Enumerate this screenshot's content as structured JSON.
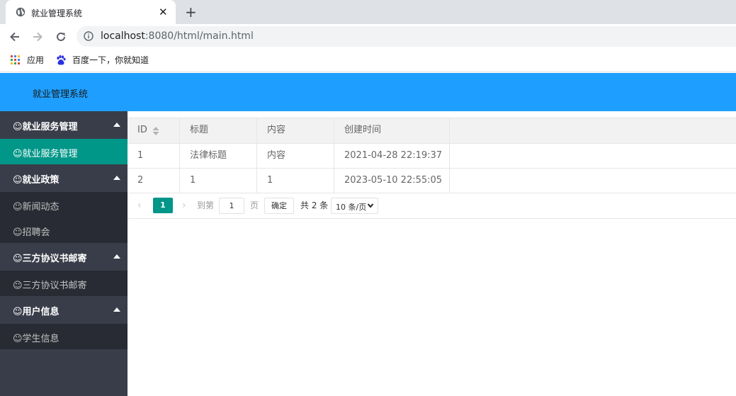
{
  "browser": {
    "tab_title": "就业管理系统",
    "tab_close": "✕",
    "new_tab": "+",
    "url_host": "localhost",
    "url_rest": ":8080/html/main.html",
    "bookmarks": [
      {
        "label": "应用",
        "icon": "apps-grid-icon"
      },
      {
        "label": "百度一下，你就知道",
        "icon": "baidu-paw-icon"
      }
    ]
  },
  "app": {
    "title": "就业管理系统",
    "accent_color": "#1e9fff",
    "active_color": "#009688"
  },
  "sidebar": {
    "groups": [
      {
        "label": "☺就业服务管理",
        "items": [
          {
            "label": "☺就业服务管理",
            "active": true
          }
        ]
      },
      {
        "label": "☺就业政策",
        "items": [
          {
            "label": "☺新闻动态"
          },
          {
            "label": "☺招聘会"
          }
        ]
      },
      {
        "label": "☺三方协议书邮寄",
        "items": [
          {
            "label": "☺三方协议书邮寄"
          }
        ]
      },
      {
        "label": "☺用户信息",
        "items": [
          {
            "label": "☺学生信息"
          }
        ]
      }
    ]
  },
  "table": {
    "columns": [
      "ID",
      "标题",
      "内容",
      "创建时间"
    ],
    "rows": [
      [
        "1",
        "法律标题",
        "内容",
        "2021-04-28 22:19:37"
      ],
      [
        "2",
        "1",
        "1",
        "2023-05-10 22:55:05"
      ]
    ]
  },
  "pager": {
    "prev": "‹",
    "current_page": "1",
    "next": "›",
    "goto_label": "到第",
    "goto_value": "1",
    "page_label": "页",
    "confirm_label": "确定",
    "total_label": "共 2 条",
    "page_size": "10 条/页"
  }
}
